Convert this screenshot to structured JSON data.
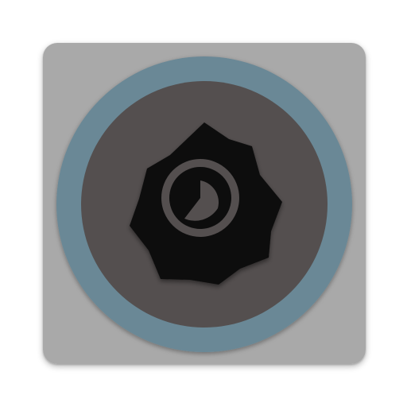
{
  "icon": {
    "name": "sun-clock-icon",
    "colors": {
      "tile": "#a9a9a9",
      "ring": "#6b8896",
      "disc": "#544f4f",
      "badge": "#0d0d0d",
      "clock_ring": "#544f4f"
    }
  }
}
